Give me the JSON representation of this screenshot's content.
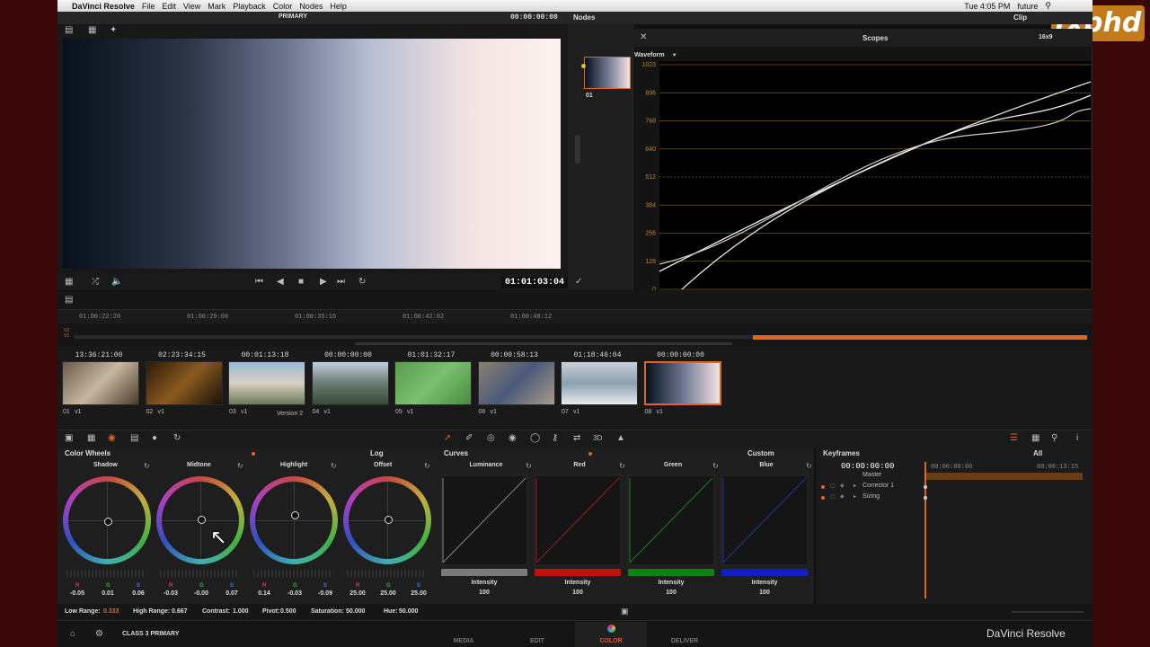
{
  "menubar": {
    "apple": "",
    "app": "DaVinci Resolve",
    "items": [
      "File",
      "Edit",
      "View",
      "Mark",
      "Playback",
      "Color",
      "Nodes",
      "Help"
    ],
    "clock": "Tue 4:05 PM",
    "user": "future"
  },
  "watermark": "fxphd",
  "viewer": {
    "title": "PRIMARY",
    "timecode": "00:00:00:00",
    "playhead": "01:01:03:04"
  },
  "nodes": {
    "title": "Nodes",
    "clip_label": "Clip",
    "node_label": "01"
  },
  "scopes": {
    "title": "Scopes",
    "mode": "Waveform",
    "aspect": "16x9",
    "ticks": [
      "1023",
      "896",
      "768",
      "640",
      "512",
      "384",
      "256",
      "128",
      "0"
    ]
  },
  "timeline": {
    "ruler": [
      "01:00:22:20",
      "01:00:29:06",
      "01:00:35:16",
      "01:00:42:02",
      "01:00:48:12"
    ],
    "tracks": [
      "V2",
      "V1"
    ]
  },
  "clips": [
    {
      "tc": "13:36:21:00",
      "num": "01",
      "v": "v1",
      "extra": ""
    },
    {
      "tc": "02:23:34:15",
      "num": "02",
      "v": "v1",
      "extra": ""
    },
    {
      "tc": "00:01:13:18",
      "num": "03",
      "v": "v1",
      "extra": "Version 2"
    },
    {
      "tc": "00:00:00:00",
      "num": "04",
      "v": "v1",
      "extra": ""
    },
    {
      "tc": "01:01:32:17",
      "num": "05",
      "v": "v1",
      "extra": ""
    },
    {
      "tc": "00:00:58:13",
      "num": "06",
      "v": "v1",
      "extra": ""
    },
    {
      "tc": "01:18:46:04",
      "num": "07",
      "v": "v1",
      "extra": ""
    },
    {
      "tc": "00:00:00:00",
      "num": "08",
      "v": "v1",
      "extra": ""
    }
  ],
  "color_wheels": {
    "title": "Color Wheels",
    "mode": "Log",
    "wheels": [
      {
        "name": "Shadow",
        "r": "-0.05",
        "g": "0.01",
        "b": "0.06"
      },
      {
        "name": "Midtone",
        "r": "-0.03",
        "g": "-0.00",
        "b": "0.07"
      },
      {
        "name": "Highlight",
        "r": "0.14",
        "g": "-0.03",
        "b": "-0.09"
      },
      {
        "name": "Offset",
        "r": "25.00",
        "g": "25.00",
        "b": "25.00"
      }
    ],
    "channel_labels": {
      "r": "R",
      "g": "G",
      "b": "B"
    }
  },
  "curves": {
    "title": "Curves",
    "mode": "Custom",
    "channels": [
      {
        "name": "Luminance",
        "intensity_label": "Intensity",
        "intensity": "100"
      },
      {
        "name": "Red",
        "intensity_label": "Intensity",
        "intensity": "100"
      },
      {
        "name": "Green",
        "intensity_label": "Intensity",
        "intensity": "100"
      },
      {
        "name": "Blue",
        "intensity_label": "Intensity",
        "intensity": "100"
      }
    ]
  },
  "keyframes": {
    "title": "Keyframes",
    "filter": "All",
    "timecode": "00:00:00:00",
    "ruler_start": "00:00:00:00",
    "ruler_end": "00:00:13:15",
    "rows": [
      "Master",
      "Corrector 1",
      "Sizing"
    ]
  },
  "status_bar": {
    "low_range_label": "Low Range:",
    "low_range": "0.333",
    "high_range_label": "High Range:",
    "high_range": "0.667",
    "contrast_label": "Contrast:",
    "contrast": "1.000",
    "pivot_label": "Pivot:",
    "pivot": "0.500",
    "saturation_label": "Saturation:",
    "saturation": "50.000",
    "hue_label": "Hue:",
    "hue": "50.000"
  },
  "bottom": {
    "project": "CLASS 3 PRIMARY",
    "tabs": [
      "MEDIA",
      "EDIT",
      "COLOR",
      "DELIVER"
    ],
    "brand": "DaVinci Resolve"
  },
  "colors": {
    "accent": "#e0661f",
    "panel": "#1c1c1c"
  }
}
